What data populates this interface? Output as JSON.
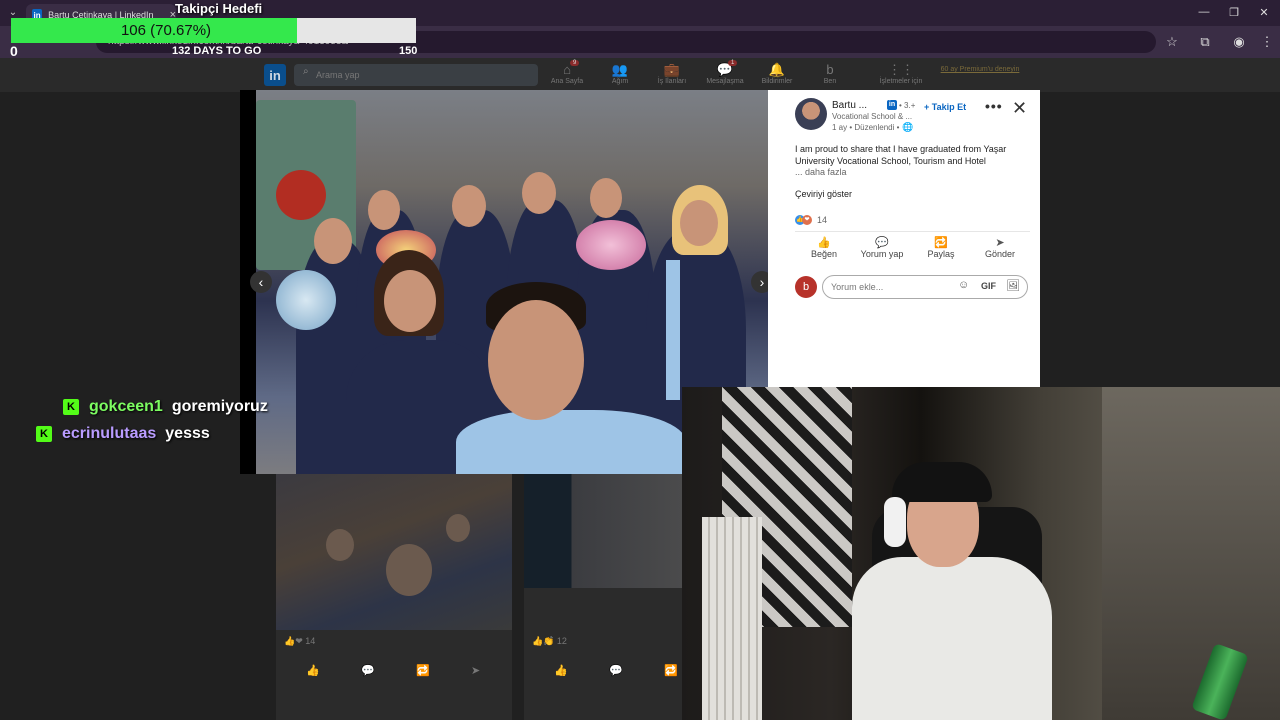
{
  "browser": {
    "tab_title": "Bartu Çetinkaya | LinkedIn",
    "url": "https://www.linkedin.com/in/bartu-cetinkaya-4913953a/"
  },
  "goal": {
    "title": "Takipçi Hedefi",
    "progress_text": "106 (70.67%)",
    "progress_fraction": 0.7067,
    "start_value": "0",
    "days_left": "132 DAYS TO GO",
    "target_value": "150"
  },
  "linkedin": {
    "logo": "in",
    "search_placeholder": "Arama yap",
    "nav": [
      {
        "label": "Ana Sayfa",
        "icon": "home-icon",
        "glyph": "⌂",
        "badge": "9"
      },
      {
        "label": "Ağım",
        "icon": "network-icon",
        "glyph": "👥",
        "badge": ""
      },
      {
        "label": "İş İlanları",
        "icon": "jobs-icon",
        "glyph": "💼",
        "badge": ""
      },
      {
        "label": "Mesajlaşma",
        "icon": "messaging-icon",
        "glyph": "💬",
        "badge": "1"
      },
      {
        "label": "Bildirimler",
        "icon": "bell-icon",
        "glyph": "🔔",
        "badge": ""
      },
      {
        "label": "Ben",
        "icon": "me-icon",
        "glyph": "b",
        "badge": ""
      },
      {
        "label": "İşletmeler için",
        "icon": "grid-icon",
        "glyph": "⋮⋮",
        "badge": ""
      }
    ],
    "premium": "60 ay Premium'u deneyin",
    "bg_posts": [
      {
        "reactions": "14"
      },
      {
        "reactions": "12"
      }
    ]
  },
  "post": {
    "author_name": "Bartu ...",
    "author_degree": "• 3.+",
    "author_headline": "Vocational School & ...",
    "time": "1 ay • Düzenlendi •",
    "follow_label": "+ Takip Et",
    "text": "I am proud to share that I have graduated from Yaşar University Vocational School, Tourism and Hotel",
    "see_more": "... daha fazla",
    "translation": "Çeviriyi göster",
    "reaction_count": "14",
    "actions": [
      {
        "label": "Beğen",
        "icon": "like-icon",
        "glyph": "👍"
      },
      {
        "label": "Yorum yap",
        "icon": "comment-icon",
        "glyph": "💬"
      },
      {
        "label": "Paylaş",
        "icon": "repost-icon",
        "glyph": "🔁"
      },
      {
        "label": "Gönder",
        "icon": "send-icon",
        "glyph": "➤"
      }
    ],
    "comment_placeholder": "Yorum ekle...",
    "commenter_initial": "b",
    "gif_label": "GIF"
  },
  "chat": [
    {
      "user": "gokceen1",
      "message": "goremiyoruz",
      "color": "#7CFC61"
    },
    {
      "user": "ecrinulutaas",
      "message": "yesss",
      "color": "#B99CFF"
    }
  ]
}
